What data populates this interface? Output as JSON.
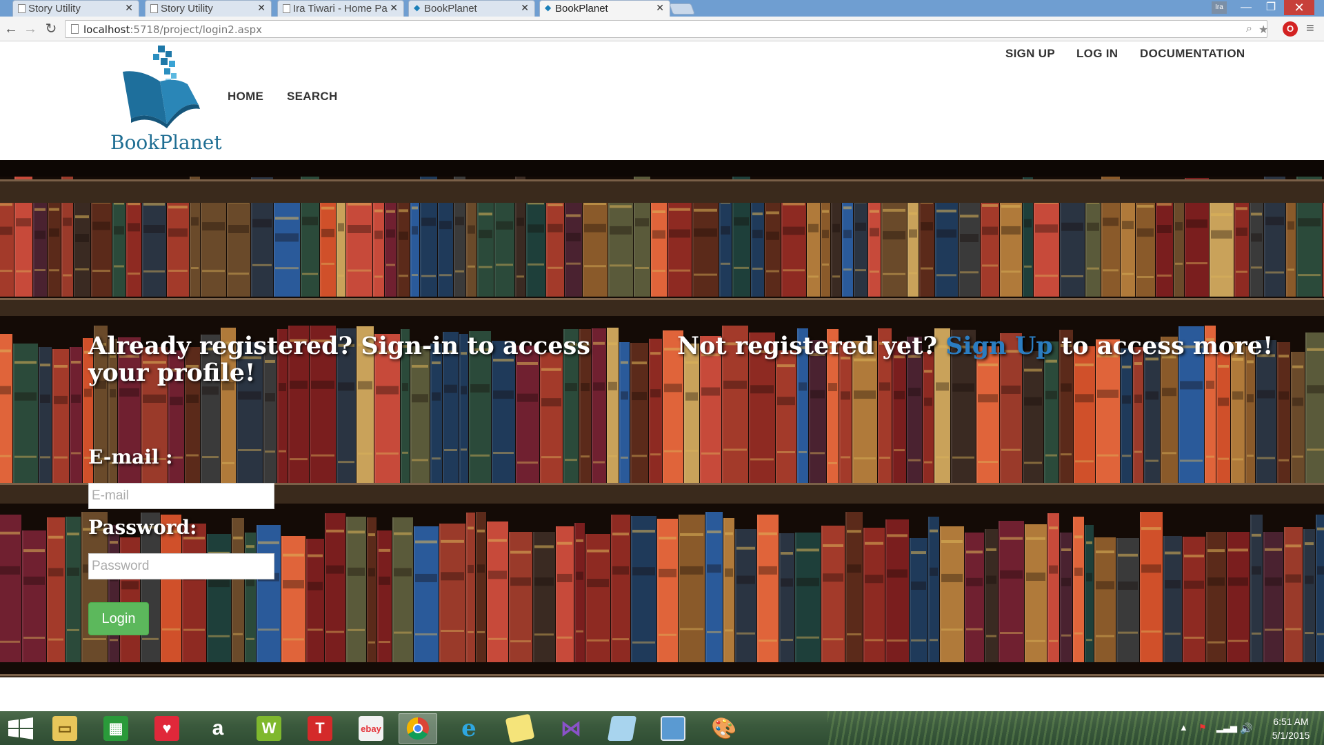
{
  "browser": {
    "tabs": [
      {
        "title": "Story Utility",
        "active": false
      },
      {
        "title": "Story Utility",
        "active": false
      },
      {
        "title": "Ira Tiwari - Home Pa",
        "active": false
      },
      {
        "title": "BookPlanet",
        "active": false
      },
      {
        "title": "BookPlanet",
        "active": true
      }
    ],
    "user_badge": "Ira",
    "url_host": "localhost",
    "url_path": ":5718/project/login2.aspx"
  },
  "site": {
    "logo_text": "BookPlanet",
    "nav": {
      "home": "HOME",
      "search": "SEARCH"
    },
    "top_nav": {
      "signup": "SIGN UP",
      "login": "LOG IN",
      "docs": "DOCUMENTATION"
    }
  },
  "hero": {
    "left_heading": "Already registered? Sign-in to access your profile!",
    "right_heading_before": "Not registered yet? ",
    "right_heading_link": "Sign Up",
    "right_heading_after": " to access more!",
    "email_label": "E-mail :",
    "email_placeholder": "E-mail",
    "password_label": "Password:",
    "password_placeholder": "Password",
    "login_button": "Login"
  },
  "taskbar": {
    "apps": [
      "file-explorer",
      "store",
      "heart-app",
      "amazon",
      "wordament",
      "t-app",
      "ebay",
      "chrome",
      "internet-explorer",
      "sticky-notes",
      "visual-studio",
      "notepad",
      "photos",
      "paint"
    ],
    "clock_time": "6:51 AM",
    "clock_date": "5/1/2015"
  },
  "colors": {
    "link_blue": "#2b7dc1",
    "login_green": "#5cb85c",
    "logo_blue": "#1f6e93"
  }
}
